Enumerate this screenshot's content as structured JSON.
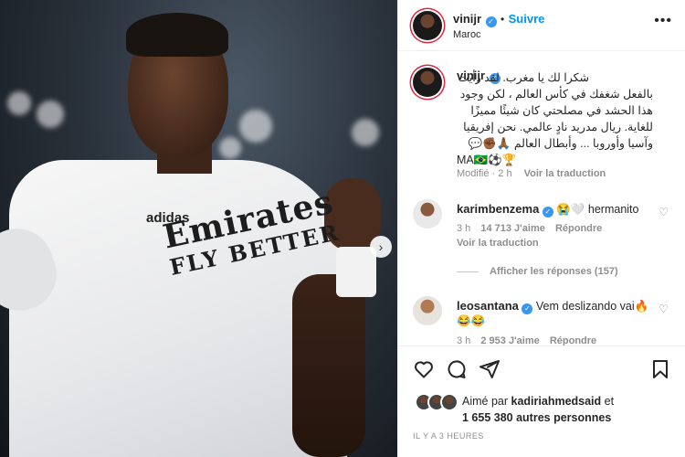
{
  "post": {
    "author": "vinijr",
    "follow_label": "Suivre",
    "location": "Maroc",
    "more_icon": "more-horizontal-icon"
  },
  "caption": {
    "author": "vinijr",
    "lines": [
      "شكرا لك يا مغرب. لقد رأيت",
      "بالفعل شغفك في كأس العالم ، لكن وجود",
      "هذا الحشد في مصلحتي كان شيئًا مميزًا",
      "للغاية. ريال مدريد نادٍ عالمي. نحن إفريقيا",
      "وآسيا وأوروبا ... وأبطال العالم 🙏🏾✊🏾💬",
      "MA🇧🇷⚽🏆"
    ],
    "edited_label": "Modifié",
    "time": "2 h",
    "translate_label": "Voir la traduction"
  },
  "comments": [
    {
      "user": "karimbenzema",
      "text": "😭🤍 hermanito",
      "time": "3 h",
      "likes": "14 713 J'aime",
      "reply_label": "Répondre",
      "translate_label": "Voir la traduction",
      "view_replies": "Afficher les réponses (157)"
    },
    {
      "user": "leosantana",
      "text": "Vem deslizando vai🔥",
      "text2": "😂😂",
      "time": "3 h",
      "likes": "2 953 J'aime",
      "reply_label": "Répondre"
    }
  ],
  "likes": {
    "prefix": "Aimé par",
    "user": "kadiriahmedsaid",
    "and": "et",
    "count": "1 655 380",
    "suffix": "autres personnes"
  },
  "timestamp": "IL Y A 3 HEURES",
  "photo": {
    "sponsor_line1": "Emirates",
    "sponsor_line2": "FLY BETTER",
    "brand": "adidas",
    "next_icon": "chevron-right-icon"
  },
  "colors": {
    "accent": "#0095f6",
    "verified": "#3897f0",
    "muted": "#8e8e8e"
  }
}
